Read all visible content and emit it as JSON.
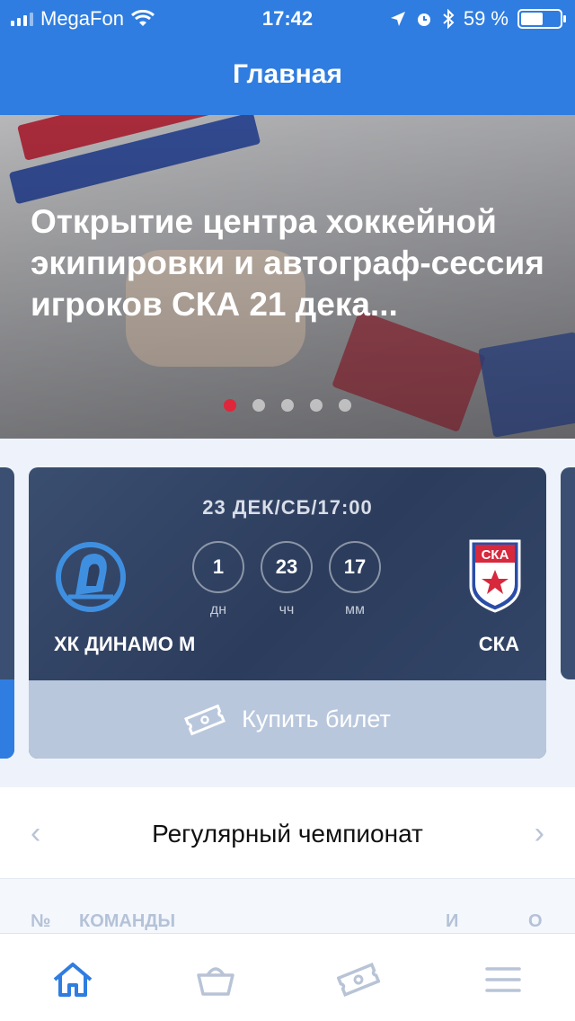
{
  "status_bar": {
    "carrier": "MegaFon",
    "time": "17:42",
    "battery": "59 %",
    "icons": [
      "signal-icon",
      "wifi-icon",
      "location-icon",
      "alarm-icon",
      "bluetooth-icon",
      "battery-icon"
    ]
  },
  "nav": {
    "title": "Главная"
  },
  "hero": {
    "title": "Открытие центра хоккейной экипировки и автограф-сессия игроков СКА 21 дека...",
    "slides": 5,
    "active_slide": 1
  },
  "match": {
    "datetime": "23 ДЕК/СБ/17:00",
    "home_team": "ХК ДИНАМО М",
    "away_team": "СКА",
    "away_logo_text": "СКА",
    "countdown": [
      {
        "value": "1",
        "unit": "дн"
      },
      {
        "value": "23",
        "unit": "чч"
      },
      {
        "value": "17",
        "unit": "мм"
      }
    ],
    "buy_label": "Купить билет"
  },
  "championship": {
    "title": "Регулярный чемпионат",
    "prev_icon": "‹",
    "next_icon": "›"
  },
  "table": {
    "columns": {
      "num": "№",
      "teams": "КОМАНДЫ",
      "games": "И",
      "points": "О"
    }
  },
  "tabbar": {
    "items": [
      "home-icon",
      "basket-icon",
      "ticket-icon",
      "menu-icon"
    ],
    "active": 0
  },
  "colors": {
    "accent": "#2f7de0",
    "card_dark": "#34486b",
    "buy_button": "#b9c7dd",
    "dot_active": "#e0263b",
    "ska_red": "#d7283c"
  }
}
